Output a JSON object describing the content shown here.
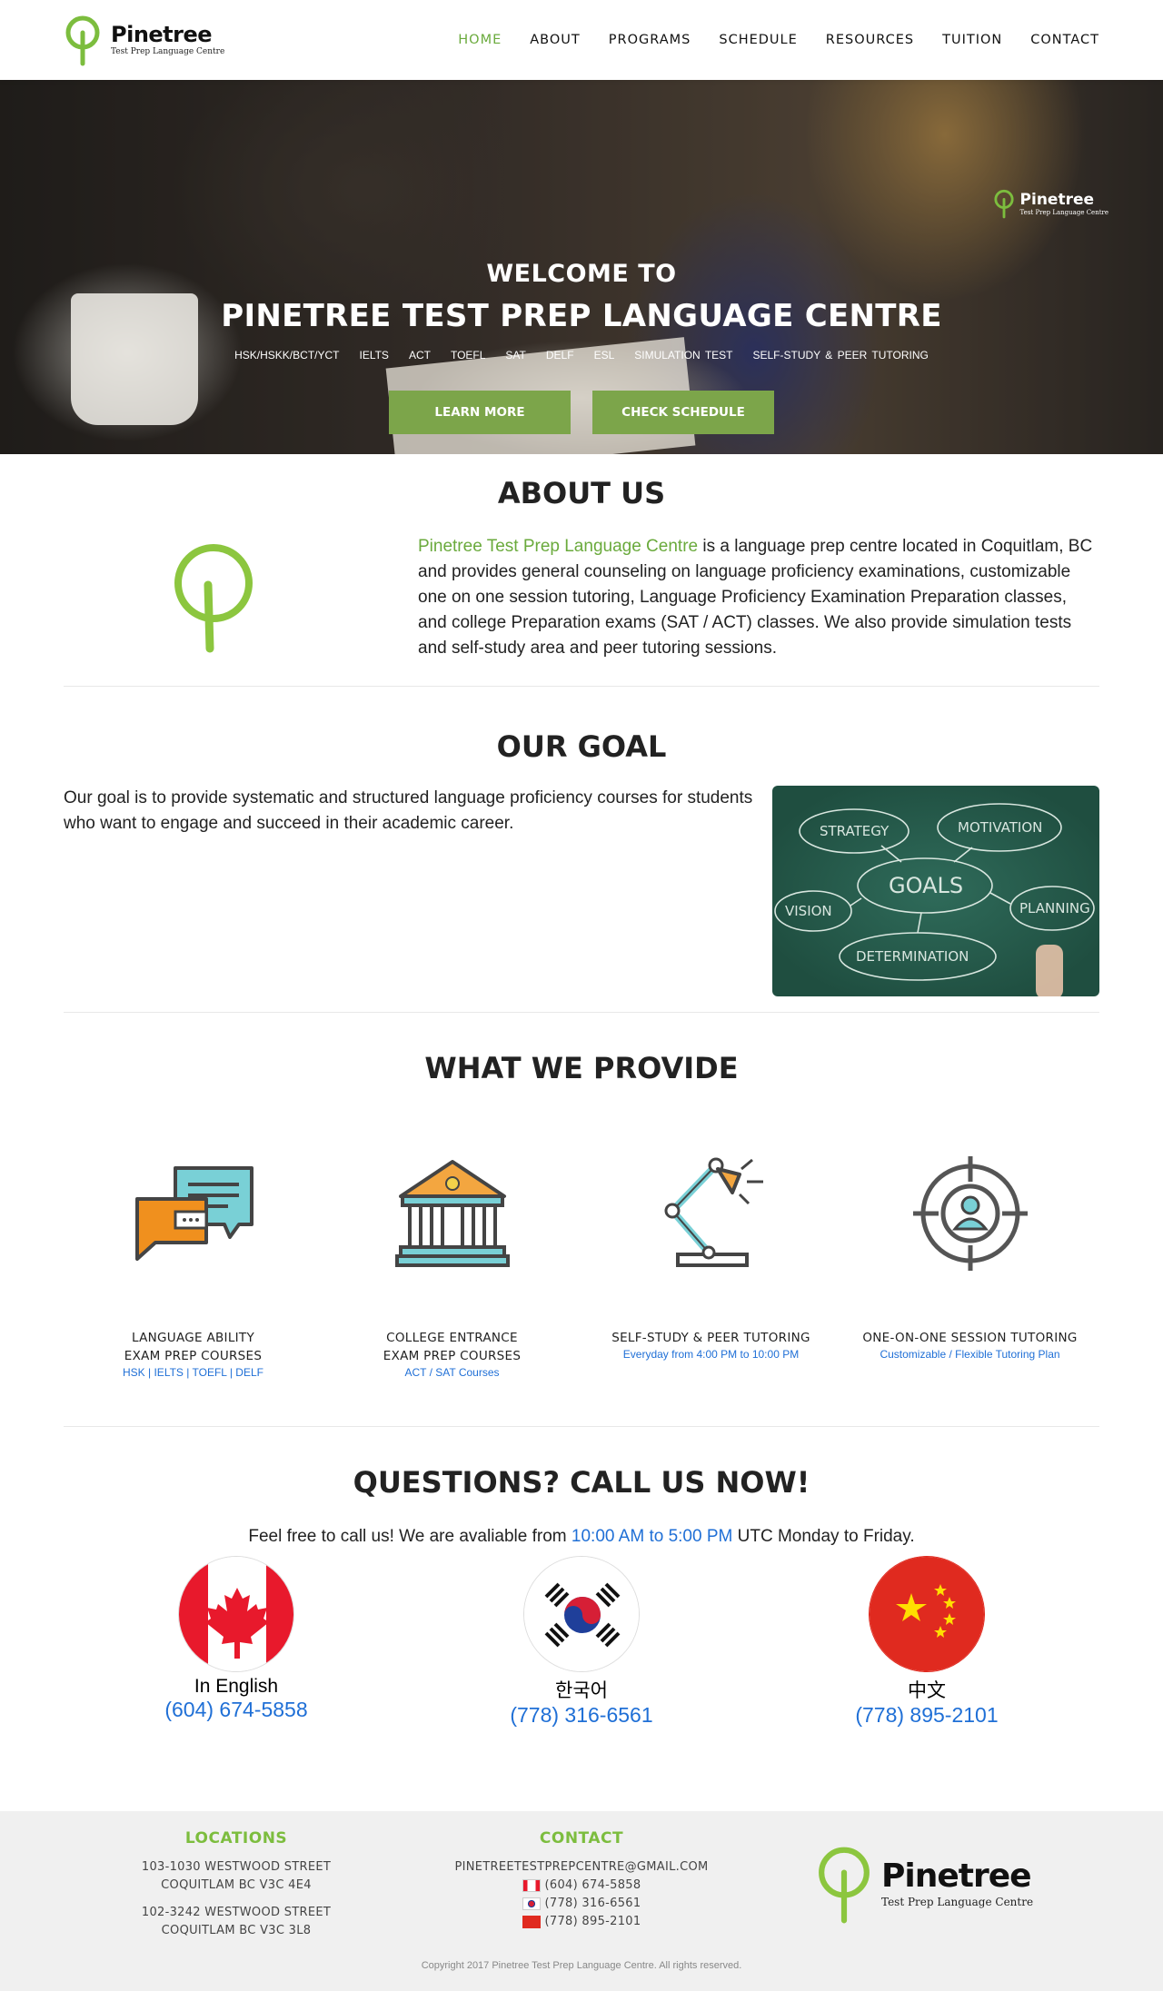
{
  "brand": {
    "name": "Pinetree",
    "tagline": "Test Prep Language Centre",
    "accent": "#6aaa3c",
    "button_color": "#7ca54a",
    "link_color": "#1f6fd6"
  },
  "nav": [
    {
      "label": "HOME",
      "active": true
    },
    {
      "label": "ABOUT"
    },
    {
      "label": "PROGRAMS"
    },
    {
      "label": "SCHEDULE"
    },
    {
      "label": "RESOURCES"
    },
    {
      "label": "TUITION"
    },
    {
      "label": "CONTACT"
    }
  ],
  "hero": {
    "welcome": "WELCOME TO",
    "title": "PINETREE TEST PREP LANGUAGE CENTRE",
    "subjects": [
      "HSK/HSKK/BCT/YCT",
      "IELTS",
      "ACT",
      "TOEFL",
      "SAT",
      "DELF",
      "ESL",
      "SIMULATION TEST",
      "SELF-STUDY & PEER TUTORING"
    ],
    "learn_more": "LEARN MORE",
    "check_schedule": "CHECK SCHEDULE"
  },
  "about": {
    "title": "ABOUT US",
    "highlight": "Pinetree Test Prep Language Centre",
    "body": " is a language prep centre located in Coquitlam, BC and provides general counseling on language proficiency examinations, customizable one on one session tutoring, Language Proficiency Examination Preparation classes, and college Preparation exams (SAT / ACT) classes. We also provide simulation tests and self-study area and peer tutoring sessions."
  },
  "goal": {
    "title": "OUR GOAL",
    "body": "Our goal is to provide systematic and structured language proficiency courses for students who want to engage and succeed in their academic career.",
    "board_words": [
      "STRATEGY",
      "MOTIVATION",
      "GOALS",
      "VISION",
      "PLANNING",
      "DETERMINATION"
    ]
  },
  "provide": {
    "title": "WHAT WE PROVIDE",
    "items": [
      {
        "line1": "LANGUAGE ABILITY",
        "line2": "EXAM PREP COURSES",
        "sub": "HSK | IELTS | TOEFL | DELF",
        "icon": "chat-bubbles-icon"
      },
      {
        "line1": "COLLEGE ENTRANCE",
        "line2": "EXAM PREP COURSES",
        "sub": "ACT / SAT Courses",
        "icon": "college-building-icon"
      },
      {
        "line1": "SELF-STUDY & PEER TUTORING",
        "line2": "",
        "sub": "Everyday from 4:00 PM to 10:00 PM",
        "icon": "desk-lamp-icon"
      },
      {
        "line1": "ONE-ON-ONE SESSION TUTORING",
        "line2": "",
        "sub": "Customizable / Flexible Tutoring Plan",
        "icon": "target-person-icon"
      }
    ]
  },
  "call": {
    "title": "QUESTIONS? CALL US NOW!",
    "line_before": "Feel free to call us! We are avaliable from ",
    "hours": "10:00 AM to 5:00 PM",
    "line_after": " UTC Monday to Friday.",
    "contacts": [
      {
        "label": "In English",
        "phone": "(604) 674-5858",
        "flag": "canada-flag-icon"
      },
      {
        "label": "한국어",
        "phone": "(778) 316-6561",
        "flag": "korea-flag-icon"
      },
      {
        "label": "中文",
        "phone": "(778) 895-2101",
        "flag": "china-flag-icon"
      }
    ]
  },
  "footer": {
    "locations_head": "LOCATIONS",
    "loc1a": "103-1030 WESTWOOD STREET",
    "loc1b": "COQUITLAM BC V3C 4E4",
    "loc2a": "102-3242 WESTWOOD STREET",
    "loc2b": "COQUITLAM BC V3C 3L8",
    "contact_head": "CONTACT",
    "email": "PINETREETESTPREPCENTRE@GMAIL.COM",
    "phones": [
      "(604) 674-5858",
      "(778) 316-6561",
      "(778) 895-2101"
    ],
    "copyright": "Copyright 2017 Pinetree Test Prep Language Centre. All rights reserved."
  }
}
